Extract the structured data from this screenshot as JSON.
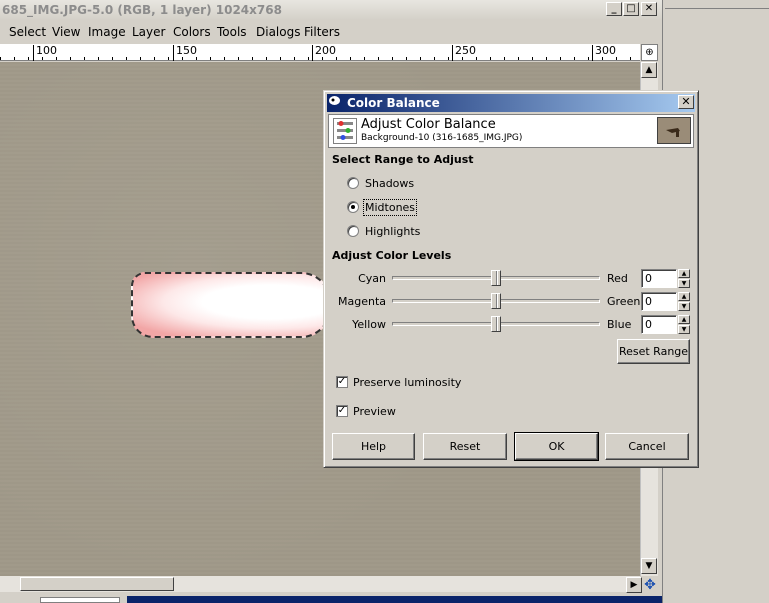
{
  "window": {
    "title": "685_IMG.JPG-5.0 (RGB, 1 layer) 1024x768",
    "controls": {
      "minimize": "_",
      "maximize": "□",
      "close": "✕"
    }
  },
  "menubar": [
    "Select",
    "View",
    "Image",
    "Layer",
    "Colors",
    "Tools",
    "Dialogs",
    "Filters"
  ],
  "ruler": [
    "100",
    "150",
    "200",
    "250",
    "300"
  ],
  "dialog": {
    "title": "Color Balance",
    "close": "✕",
    "header_title": "Adjust Color Balance",
    "header_subtitle": "Background-10 (316-1685_IMG.JPG)",
    "range_section": "Select Range to Adjust",
    "ranges": [
      {
        "label": "Shadows",
        "selected": false
      },
      {
        "label": "Midtones",
        "selected": true
      },
      {
        "label": "Highlights",
        "selected": false
      }
    ],
    "levels_section": "Adjust Color Levels",
    "sliders": [
      {
        "left": "Cyan",
        "right": "Red",
        "value": "0"
      },
      {
        "left": "Magenta",
        "right": "Green",
        "value": "0"
      },
      {
        "left": "Yellow",
        "right": "Blue",
        "value": "0"
      }
    ],
    "reset_range": "Reset Range",
    "preserve_luminosity": "Preserve luminosity",
    "preview": "Preview",
    "buttons": {
      "help": "Help",
      "reset": "Reset",
      "ok": "OK",
      "cancel": "Cancel"
    }
  }
}
